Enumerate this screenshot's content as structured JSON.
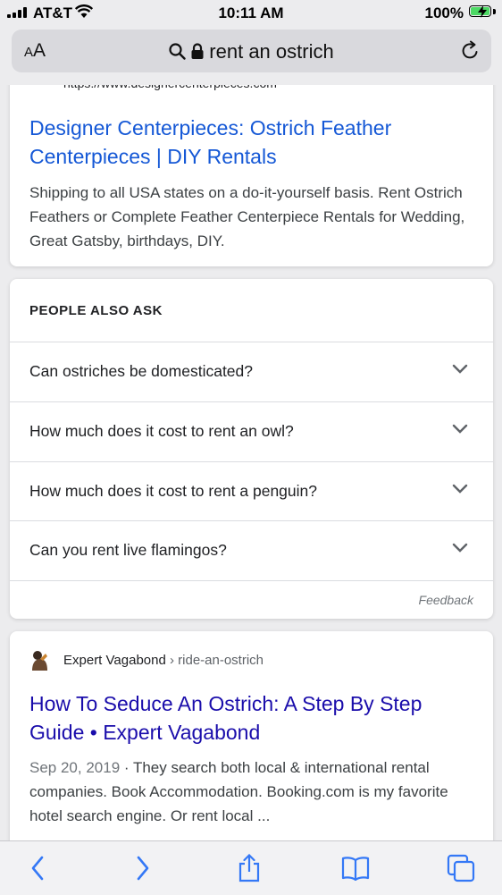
{
  "status_bar": {
    "carrier": "AT&T",
    "time": "10:11 AM",
    "battery_percent": "100%",
    "battery_level": 1.0,
    "battery_color": "#4cd964",
    "icons": [
      "signal-icon",
      "wifi-icon",
      "battery-icon",
      "charging-icon"
    ]
  },
  "address_bar": {
    "text_size_button": {
      "big": "A",
      "small": "A"
    },
    "query": "rent an ostrich",
    "icons": [
      "search-icon",
      "lock-icon",
      "reload-icon"
    ]
  },
  "results": {
    "first": {
      "url": "https://www.designercenterpieces.com",
      "title": "Designer Centerpieces: Ostrich Feather Centerpieces | DIY Rentals",
      "snippet": "Shipping to all USA states on a do-it-yourself basis. Rent Ostrich Feathers or Complete Feather Centerpiece Rentals for Wedding, Great Gatsby, birthdays, DIY."
    },
    "people_also_ask": {
      "heading": "PEOPLE ALSO ASK",
      "questions": [
        "Can ostriches be domesticated?",
        "How much does it cost to rent an owl?",
        "How much does it cost to rent a penguin?",
        "Can you rent live flamingos?"
      ],
      "feedback": "Feedback"
    },
    "second": {
      "site_name": "Expert Vagabond",
      "path": "› ride-an-ostrich",
      "title": "How To Seduce An Ostrich: A Step By Step Guide • Expert Vagabond",
      "date": "Sep 20, 2019",
      "snippet": " · They search both local & international rental companies. Book Accommodation. Booking.com is my favorite hotel search engine. Or rent local ..."
    }
  },
  "toolbar": {
    "buttons": [
      "back-icon",
      "forward-icon",
      "share-icon",
      "bookmarks-icon",
      "tabs-icon"
    ],
    "accent": "#3478f6"
  },
  "colors": {
    "link_visited": "#1a0dab",
    "link": "#1558d6",
    "background": "#ececee"
  }
}
